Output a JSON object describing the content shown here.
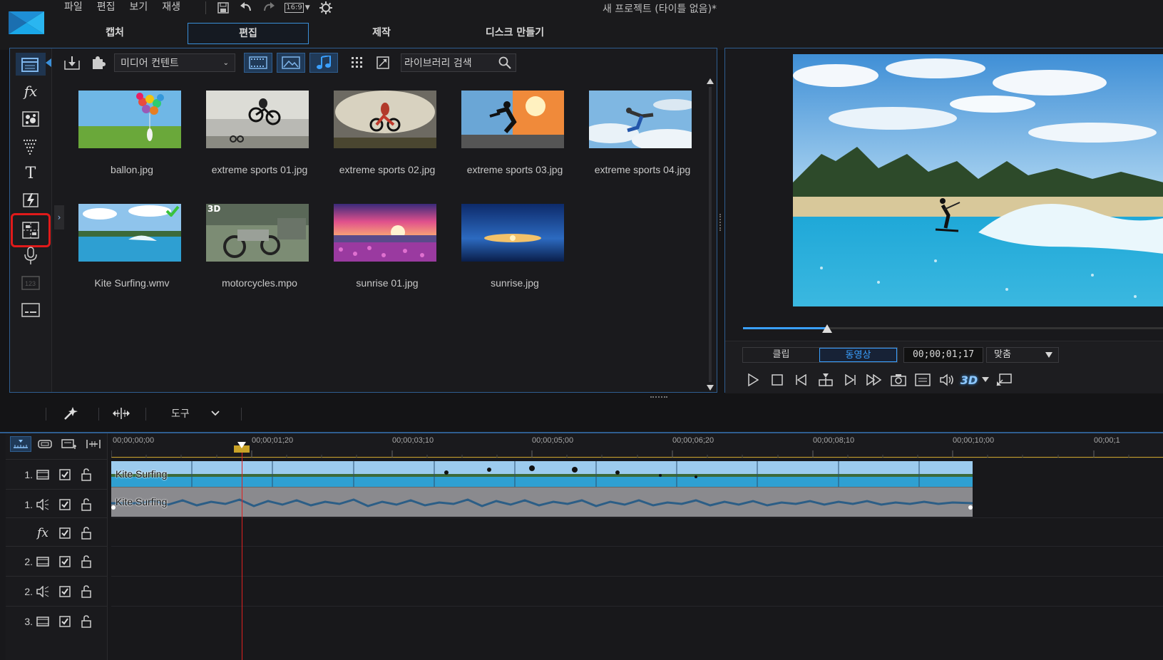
{
  "menu": [
    "파일",
    "편집",
    "보기",
    "재생"
  ],
  "quick_tools": {
    "aspect_label": "16:9"
  },
  "window_title": "새 프로젝트 (타이틀 없음)*",
  "mode_tabs": [
    {
      "label": "캡처",
      "active": false
    },
    {
      "label": "편집",
      "active": true
    },
    {
      "label": "제작",
      "active": false
    },
    {
      "label": "디스크 만들기",
      "active": false
    }
  ],
  "library": {
    "media_select": "미디어 컨텐트",
    "search_placeholder": "라이브러리 검색",
    "items": [
      {
        "name": "ballon.jpg",
        "icon": "balloons-thumb"
      },
      {
        "name": "extreme sports 01.jpg",
        "icon": "bmx-thumb"
      },
      {
        "name": "extreme sports 02.jpg",
        "icon": "motocross-thumb"
      },
      {
        "name": "extreme sports 03.jpg",
        "icon": "skateboard-thumb"
      },
      {
        "name": "extreme sports 04.jpg",
        "icon": "skydive-thumb"
      },
      {
        "name": "Kite Surfing.wmv",
        "icon": "kitesurf-thumb",
        "used": true
      },
      {
        "name": "motorcycles.mpo",
        "icon": "motorcycles-thumb",
        "badge": "3D"
      },
      {
        "name": "sunrise 01.jpg",
        "icon": "sunrise-field-thumb"
      },
      {
        "name": "sunrise.jpg",
        "icon": "sunrise-sea-thumb"
      }
    ]
  },
  "sidebar_icons": [
    "media-room-icon",
    "fx-room-icon",
    "particle-room-icon",
    "pip-room-icon",
    "title-room-icon",
    "transition-room-icon",
    "chapter-room-icon",
    "voice-record-icon",
    "subtitle-counter-icon",
    "subtitle-room-icon"
  ],
  "preview": {
    "mode_clip": "클립",
    "mode_movie": "동영상",
    "timecode": "00;00;01;17",
    "fit": "맞춤",
    "scrub_fraction": 0.2,
    "badge_3d": "3D"
  },
  "tools": {
    "label": "도구"
  },
  "timeline": {
    "ruler_labels": [
      "00;00;00;00",
      "00;00;01;20",
      "00;00;03;10",
      "00;00;05;00",
      "00;00;06;20",
      "00;00;08;10",
      "00;00;10;00",
      "00;00;1"
    ],
    "tracks": [
      {
        "num": "1.",
        "type": "video"
      },
      {
        "num": "1.",
        "type": "audio"
      },
      {
        "num": "fx",
        "type": "fx"
      },
      {
        "num": "2.",
        "type": "video"
      },
      {
        "num": "2.",
        "type": "audio"
      },
      {
        "num": "3.",
        "type": "video"
      }
    ],
    "video_clip": "Kite Surfing",
    "audio_clip": "Kite Surfing"
  },
  "colors": {
    "accent": "#3aa0ff",
    "highlight": "#e01a1a",
    "panel_border": "#2f5e90"
  }
}
